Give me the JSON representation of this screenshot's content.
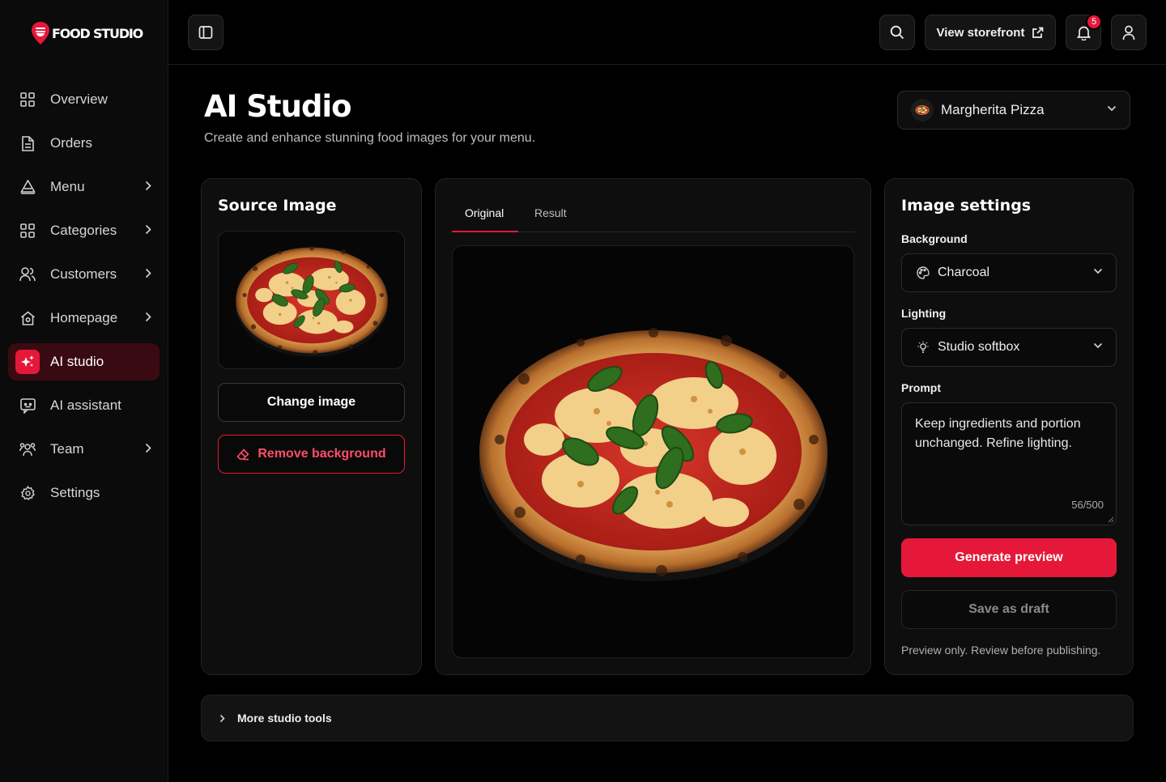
{
  "brand": {
    "name": "FOOD STUDIO",
    "accent": "#e5183a"
  },
  "sidebar": {
    "items": [
      {
        "label": "Overview",
        "icon": "grid-icon"
      },
      {
        "label": "Orders",
        "icon": "document-icon"
      },
      {
        "label": "Menu",
        "icon": "menu-tray-icon",
        "expandable": true
      },
      {
        "label": "Categories",
        "icon": "grid-icon",
        "expandable": true
      },
      {
        "label": "Customers",
        "icon": "users-icon",
        "expandable": true
      },
      {
        "label": "Homepage",
        "icon": "home-icon",
        "expandable": true
      },
      {
        "label": "AI studio",
        "icon": "sparkles-icon",
        "active": true
      },
      {
        "label": "AI assistant",
        "icon": "chat-bot-icon"
      },
      {
        "label": "Team",
        "icon": "team-icon",
        "expandable": true
      },
      {
        "label": "Settings",
        "icon": "gear-icon"
      }
    ]
  },
  "topbar": {
    "storefront_label": "View storefront",
    "notifications_count": "5"
  },
  "header": {
    "title": "AI Studio",
    "subtitle": "Create and enhance stunning food images for your menu.",
    "selected_item": "Margherita Pizza"
  },
  "source": {
    "title": "Source Image",
    "change_label": "Change image",
    "remove_bg_label": "Remove background"
  },
  "preview": {
    "tabs": [
      "Original",
      "Result"
    ],
    "active_tab": 0
  },
  "settings": {
    "title": "Image settings",
    "background_label": "Background",
    "background_value": "Charcoal",
    "lighting_label": "Lighting",
    "lighting_value": "Studio softbox",
    "prompt_label": "Prompt",
    "prompt_value": "Keep ingredients and portion unchanged. Refine lighting.",
    "prompt_counter": "56/500",
    "generate_label": "Generate preview",
    "draft_label": "Save as draft",
    "hint": "Preview only. Review before publishing."
  },
  "more_tools_label": "More studio tools"
}
